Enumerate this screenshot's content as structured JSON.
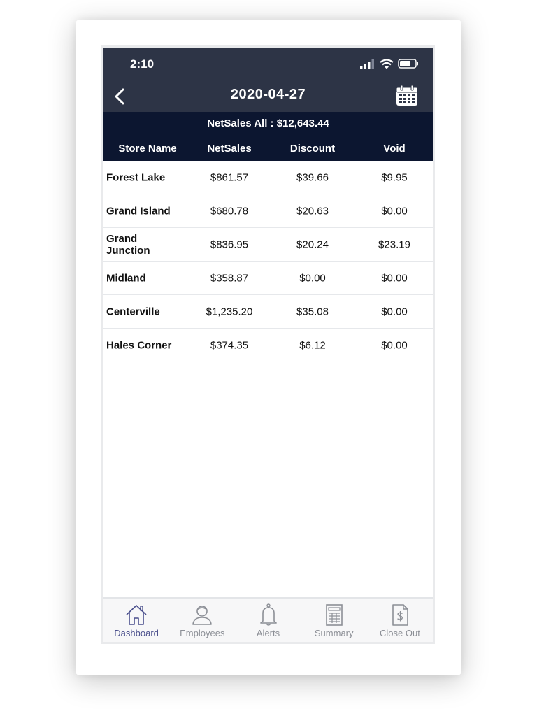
{
  "status": {
    "time": "2:10"
  },
  "nav": {
    "title": "2020-04-27"
  },
  "summary": {
    "netsales_all": "NetSales All : $12,643.44"
  },
  "columns": [
    "Store Name",
    "NetSales",
    "Discount",
    "Void"
  ],
  "rows": [
    {
      "store": "Forest Lake",
      "netsales": "$861.57",
      "discount": "$39.66",
      "void": "$9.95"
    },
    {
      "store": "Grand Island",
      "netsales": "$680.78",
      "discount": "$20.63",
      "void": "$0.00"
    },
    {
      "store": "Grand Junction",
      "netsales": "$836.95",
      "discount": "$20.24",
      "void": "$23.19"
    },
    {
      "store": "Midland",
      "netsales": "$358.87",
      "discount": "$0.00",
      "void": "$0.00"
    },
    {
      "store": "Centerville",
      "netsales": "$1,235.20",
      "discount": "$35.08",
      "void": "$0.00"
    },
    {
      "store": "Hales Corner",
      "netsales": "$374.35",
      "discount": "$6.12",
      "void": "$0.00"
    }
  ],
  "tabs": [
    {
      "label": "Dashboard",
      "icon": "home-icon",
      "active": true
    },
    {
      "label": "Employees",
      "icon": "person-icon",
      "active": false
    },
    {
      "label": "Alerts",
      "icon": "bell-icon",
      "active": false
    },
    {
      "label": "Summary",
      "icon": "report-icon",
      "active": false
    },
    {
      "label": "Close Out",
      "icon": "dollar-document-icon",
      "active": false
    }
  ],
  "colors": {
    "header": "#2d3446",
    "summary": "#0c1630",
    "active_tab": "#4a4f8c",
    "inactive_tab": "#8c8f96"
  }
}
